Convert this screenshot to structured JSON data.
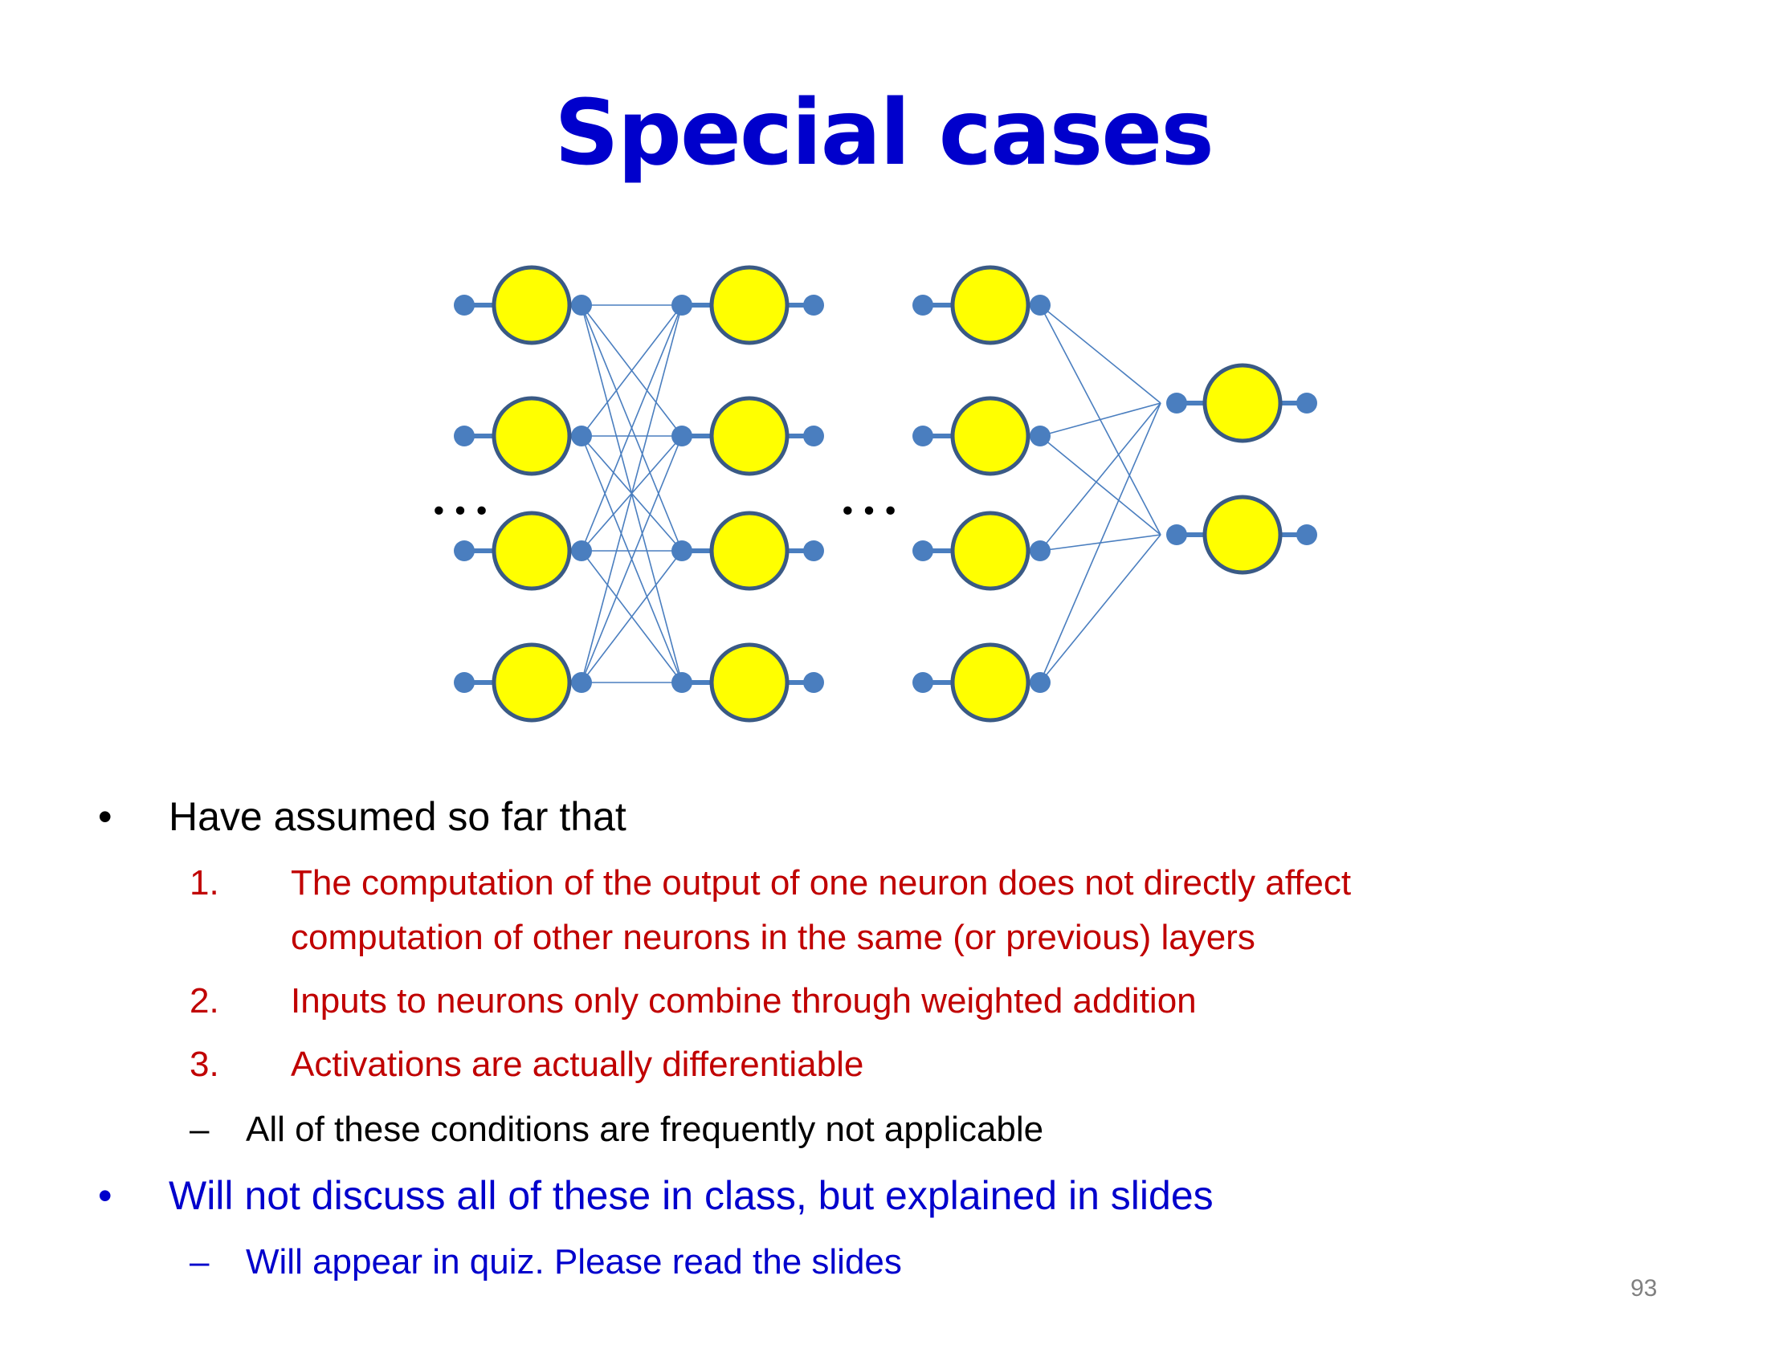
{
  "slide": {
    "title": "Special cases",
    "ellipsis_left": "…",
    "ellipsis_mid": "…",
    "page_number": "93"
  },
  "bullets": {
    "b1": {
      "marker": "•",
      "text": "Have assumed so far that"
    },
    "items": [
      {
        "number": "1.",
        "line1": "The computation of the output of one neuron does not directly affect",
        "line2": "computation of other neurons in the same (or previous) layers"
      },
      {
        "number": "2.",
        "line1": "Inputs to neurons only combine through weighted addition"
      },
      {
        "number": "3.",
        "line1": "Activations are actually differentiable"
      }
    ],
    "sub1": {
      "marker": "–",
      "text": "All of these conditions are frequently not applicable"
    },
    "b2": {
      "marker": "•",
      "text": "Will not discuss all of these in class, but explained in slides"
    },
    "sub2": {
      "marker": "–",
      "text": "Will appear in quiz.  Please read the slides"
    }
  },
  "colors": {
    "neuron_fill": "#ffff00",
    "neuron_stroke": "#3a5a85",
    "connector": "#4a7ebf",
    "title": "#0000cc",
    "numbered": "#c00000"
  },
  "icons": {
    "neuron": "circle-neuron-icon",
    "terminal": "dot-terminal-icon"
  }
}
